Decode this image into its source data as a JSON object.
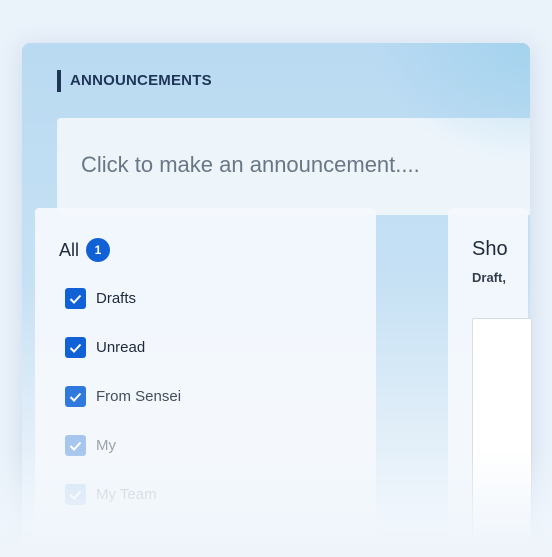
{
  "header": {
    "title": "ANNOUNCEMENTS"
  },
  "composer": {
    "prompt": "Click to make an announcement...."
  },
  "filters": {
    "all_label": "All",
    "all_count": "1",
    "options": [
      {
        "label": "Drafts",
        "checked": true
      },
      {
        "label": "Unread",
        "checked": true
      },
      {
        "label": "From Sensei",
        "checked": true
      },
      {
        "label": "My",
        "checked": true
      },
      {
        "label": "My Team",
        "checked": true
      }
    ]
  },
  "show_panel": {
    "title": "Sho",
    "subtitle": "Draft,"
  },
  "colors": {
    "accent": "#1060d6",
    "title": "#1f3556"
  }
}
